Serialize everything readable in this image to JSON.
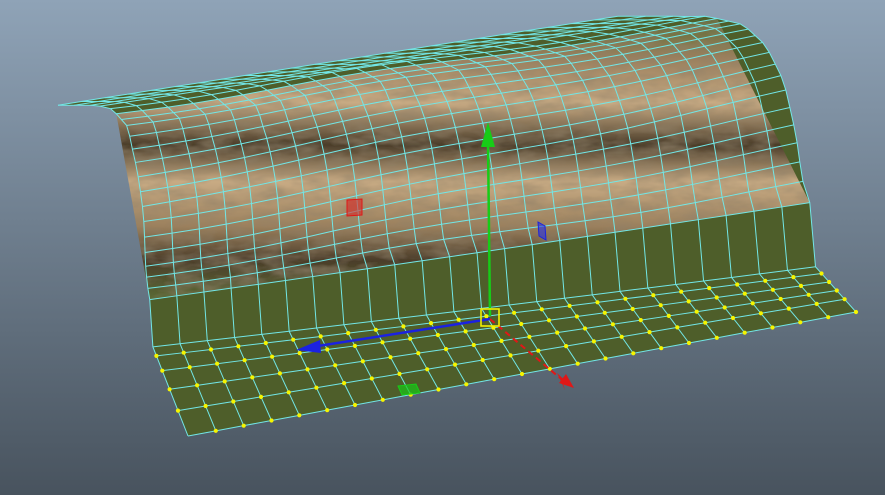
{
  "viewport": {
    "background_top": "#8fa3b7",
    "background_bottom": "#48535e"
  },
  "mesh": {
    "ground_color": "#4e5e2a",
    "wireframe_color": "#72e6e6",
    "rock_light": "#c8ab84",
    "rock_mid": "#9b805d",
    "rock_dark": "#4b3d2a",
    "moss_edge": "#5b6b35",
    "selected_vertex_color": "#f5f500"
  },
  "manipulator": {
    "y_axis_color": "#17cc17",
    "z_axis_color": "#1b22e0",
    "x_axis_color": "#e01717",
    "center_handle_color": "#f0f000",
    "icons": [
      "move-manipulator-icon",
      "y-axis-arrow-icon",
      "z-axis-arrow-icon",
      "x-axis-arrow-icon",
      "center-handle-icon",
      "xy-plane-handle-icon",
      "yz-plane-handle-icon",
      "xz-plane-handle-icon"
    ]
  }
}
